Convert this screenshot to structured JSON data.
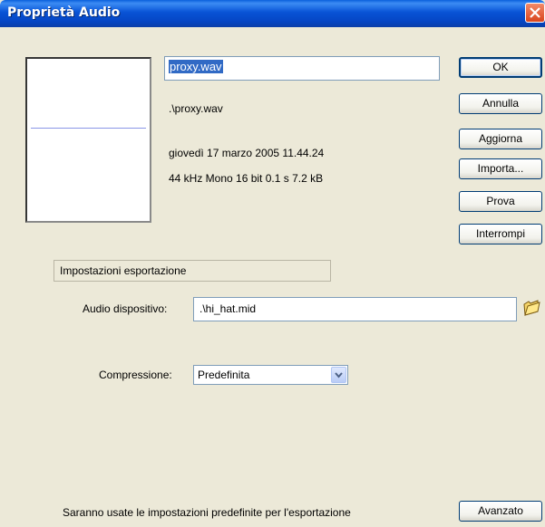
{
  "window": {
    "title": "Proprietà Audio"
  },
  "sound": {
    "name": "proxy.wav",
    "path": ".\\proxy.wav",
    "date": "giovedì 17 marzo 2005  11.44.24",
    "format": "44 kHz Mono 16 bit 0.1 s 7.2 kB"
  },
  "buttons": {
    "ok": "OK",
    "cancel": "Annulla",
    "update": "Aggiorna",
    "import": "Importa...",
    "test": "Prova",
    "stop": "Interrompi",
    "advanced": "Avanzato"
  },
  "export": {
    "section_title": "Impostazioni esportazione",
    "device_label": "Audio dispositivo:",
    "device_value": ".\\hi_hat.mid",
    "compression_label": "Compressione:",
    "compression_value": "Predefinita",
    "note": "Saranno usate le impostazioni predefinite per l'esportazione"
  },
  "icons": {
    "close": "close-icon",
    "folder": "folder-icon",
    "dropdown": "chevron-down-icon"
  },
  "colors": {
    "titlebar": "#0853d6",
    "face": "#ece9d8",
    "selection": "#316ac5",
    "close": "#d9451d"
  }
}
